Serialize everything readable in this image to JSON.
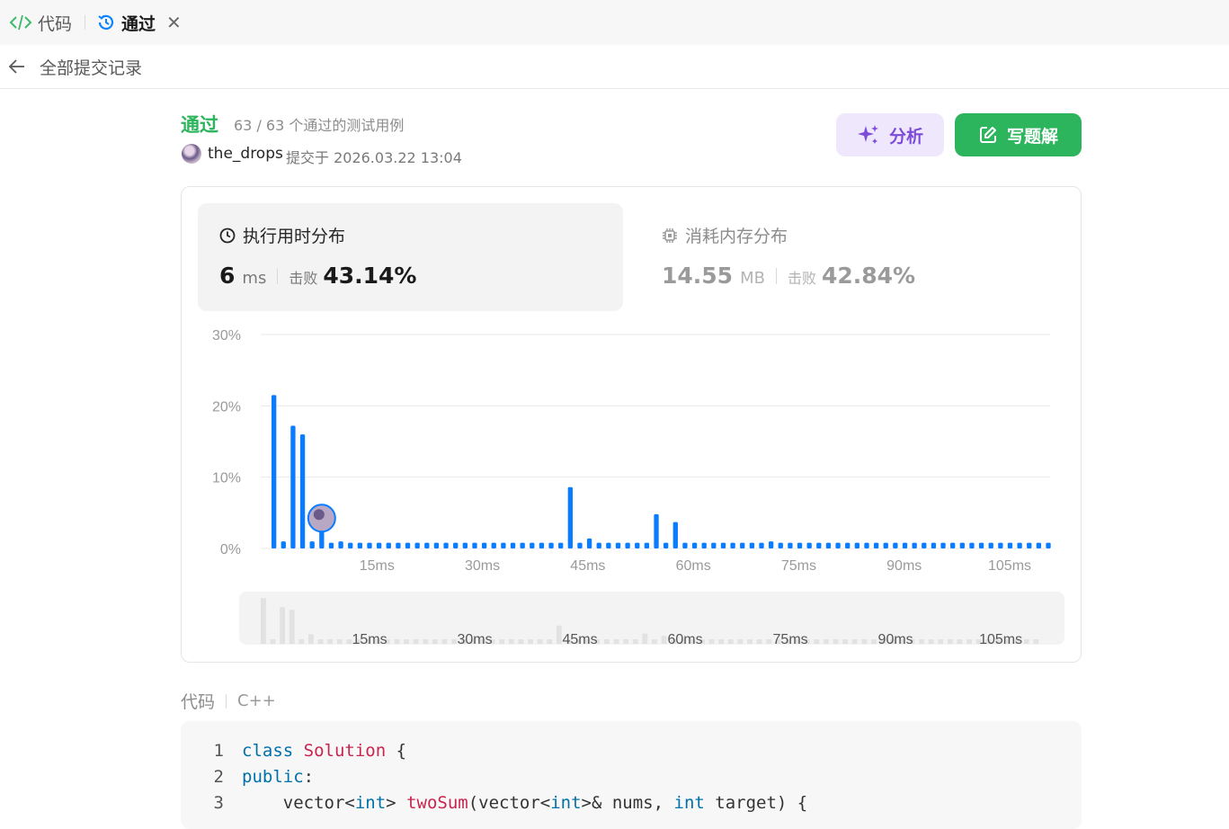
{
  "tabs": {
    "code_label": "代码",
    "pass_label": "通过"
  },
  "subbar": {
    "back_label": "全部提交记录"
  },
  "result": {
    "status": "通过",
    "passed_text": "63 / 63 个通过的测试用例",
    "username": "the_drops",
    "submitted_text": "提交于 2026.03.22 13:04"
  },
  "actions": {
    "analyze_label": "分析",
    "write_label": "写题解"
  },
  "runtime": {
    "title": "执行用时分布",
    "value": "6",
    "unit": "ms",
    "beat_label": "击败",
    "beat_value": "43.14%"
  },
  "memory": {
    "title": "消耗内存分布",
    "value": "14.55",
    "unit": "MB",
    "beat_label": "击败",
    "beat_value": "42.84%"
  },
  "colors": {
    "bar": "#0a7cff",
    "accent_green": "#2db55d",
    "accent_purple": "#7c4bd9",
    "brush_bar": "#e2e2e2"
  },
  "chart_data": {
    "type": "bar",
    "ylabels": [
      "30%",
      "20%",
      "10%",
      "0%"
    ],
    "ylim": [
      0,
      30
    ],
    "xlabels": [
      "15ms",
      "30ms",
      "45ms",
      "60ms",
      "75ms",
      "90ms",
      "105ms"
    ],
    "x": [
      0,
      1,
      2,
      3,
      4,
      5,
      6,
      7,
      8,
      9,
      10,
      11,
      12,
      13,
      14,
      15,
      16,
      17,
      18,
      19,
      20,
      21,
      22,
      23,
      24,
      25,
      26,
      27,
      28,
      29,
      30,
      31,
      32,
      33,
      34,
      35,
      36,
      37,
      38,
      39,
      40,
      41,
      42,
      43,
      44,
      45,
      46,
      47,
      48,
      49,
      50,
      51,
      52,
      53,
      54,
      55,
      56,
      57,
      58,
      59,
      60,
      61,
      62,
      63,
      64,
      65,
      66,
      67,
      68,
      69,
      70,
      71,
      72,
      73,
      74,
      75,
      76,
      77,
      78,
      79,
      80,
      81
    ],
    "values": [
      21.5,
      1,
      17.2,
      16,
      1,
      4.5,
      0.8,
      1,
      0.8,
      0.8,
      0.8,
      0.8,
      0.8,
      0.8,
      0.8,
      0.8,
      0.8,
      0.8,
      0.8,
      0.8,
      0.8,
      0.8,
      0.8,
      0.8,
      0.8,
      0.8,
      0.8,
      0.8,
      0.8,
      0.8,
      0.8,
      8.6,
      0.8,
      1.4,
      0.8,
      0.8,
      0.8,
      0.8,
      0.8,
      0.8,
      4.8,
      0.8,
      3.7,
      0.8,
      0.8,
      0.8,
      0.8,
      0.8,
      0.8,
      0.8,
      0.8,
      0.8,
      1,
      0.8,
      0.8,
      0.8,
      0.8,
      0.8,
      0.8,
      0.8,
      0.8,
      0.8,
      0.8,
      0.8,
      0.8,
      0.8,
      0.8,
      0.8,
      0.8,
      0.8,
      0.8,
      0.8,
      0.8,
      0.8,
      0.8,
      0.8,
      0.8,
      0.8,
      0.8,
      0.8,
      0.8,
      0.8
    ],
    "highlight_index": 5
  },
  "code": {
    "label": "代码",
    "language": "C++",
    "lines": [
      {
        "n": "1",
        "parts": [
          [
            "kw",
            "class "
          ],
          [
            "cls",
            "Solution"
          ],
          [
            "pl",
            " {"
          ]
        ]
      },
      {
        "n": "2",
        "parts": [
          [
            "kw",
            "public"
          ],
          [
            "pl",
            ":"
          ]
        ]
      },
      {
        "n": "3",
        "parts": [
          [
            "pl",
            "    vector<"
          ],
          [
            "ty",
            "int"
          ],
          [
            "pl",
            "> "
          ],
          [
            "fn",
            "twoSum"
          ],
          [
            "pl",
            "(vector<"
          ],
          [
            "ty",
            "int"
          ],
          [
            "pl",
            ">& nums, "
          ],
          [
            "ty",
            "int"
          ],
          [
            "pl",
            " target) {"
          ]
        ]
      }
    ]
  }
}
